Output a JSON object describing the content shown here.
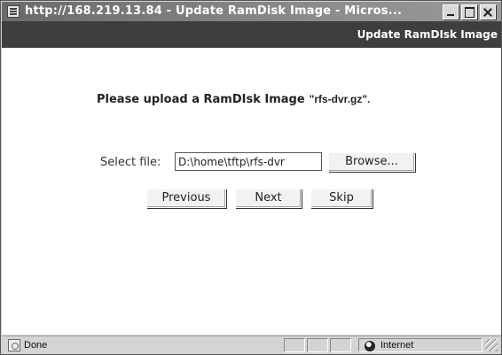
{
  "window": {
    "title": "http://168.219.13.84 - Update RamDisk Image - Micros...",
    "icon": "ie-page-icon"
  },
  "header": {
    "title": "Update RamDIsk Image"
  },
  "main": {
    "instruction": "Please upload a RamDIsk Image",
    "filename": "\"rfs-dvr.gz\".",
    "select_label": "Select file:",
    "file_value": "D:\\home\\tftp\\rfs-dvr",
    "browse_label": "Browse...",
    "buttons": {
      "previous": "Previous",
      "next": "Next",
      "skip": "Skip"
    }
  },
  "statusbar": {
    "status": "Done",
    "zone": "Internet"
  },
  "colors": {
    "header_band": "#3e3e3e",
    "titlebar": "#7a7a7a",
    "chrome": "#d4d4d4"
  }
}
